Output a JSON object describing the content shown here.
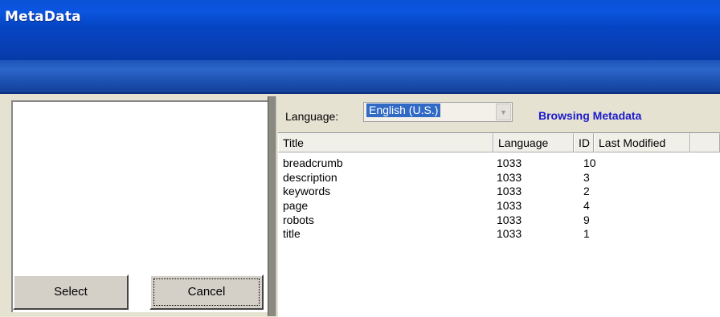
{
  "window": {
    "title": "MetaData"
  },
  "buttons": {
    "select": "Select",
    "cancel": "Cancel"
  },
  "filter": {
    "language_label": "Language:",
    "language_value": "English (U.S.)"
  },
  "status": {
    "text": "Browsing Metadata",
    "color": "#1a1acc"
  },
  "table": {
    "columns": [
      "Title",
      "Language",
      "ID",
      "Last Modified"
    ],
    "rows": [
      {
        "title": "breadcrumb",
        "language": "1033",
        "id": "10",
        "last_modified": ""
      },
      {
        "title": "description",
        "language": "1033",
        "id": "3",
        "last_modified": ""
      },
      {
        "title": "keywords",
        "language": "1033",
        "id": "2",
        "last_modified": ""
      },
      {
        "title": "page",
        "language": "1033",
        "id": "4",
        "last_modified": ""
      },
      {
        "title": "robots",
        "language": "1033",
        "id": "9",
        "last_modified": ""
      },
      {
        "title": "title",
        "language": "1033",
        "id": "1",
        "last_modified": ""
      }
    ]
  },
  "colors": {
    "title_bar": "#0545c4",
    "selection": "#316ac5",
    "background": "#ece9d8"
  }
}
